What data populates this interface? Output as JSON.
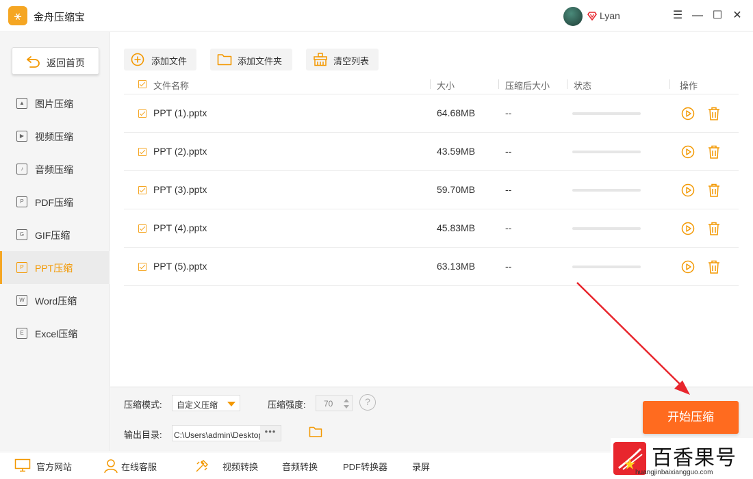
{
  "app": {
    "title": "金舟压缩宝",
    "user": "Lyan"
  },
  "window_controls": {
    "menu": "☰",
    "minimize": "—",
    "maximize": "☐",
    "close": "✕"
  },
  "sidebar": {
    "home_label": "返回首页",
    "items": [
      {
        "label": "图片压缩",
        "icon": "image-icon",
        "glyph": "▲"
      },
      {
        "label": "视频压缩",
        "icon": "video-icon",
        "glyph": "▶"
      },
      {
        "label": "音频压缩",
        "icon": "audio-icon",
        "glyph": "♪"
      },
      {
        "label": "PDF压缩",
        "icon": "pdf-icon",
        "glyph": "P"
      },
      {
        "label": "GIF压缩",
        "icon": "gif-icon",
        "glyph": "G"
      },
      {
        "label": "PPT压缩",
        "icon": "ppt-icon",
        "glyph": "P",
        "active": true
      },
      {
        "label": "Word压缩",
        "icon": "word-icon",
        "glyph": "W"
      },
      {
        "label": "Excel压缩",
        "icon": "excel-icon",
        "glyph": "E"
      }
    ]
  },
  "toolbar": {
    "add_file": "添加文件",
    "add_folder": "添加文件夹",
    "clear_list": "清空列表"
  },
  "table": {
    "headers": {
      "name": "文件名称",
      "size": "大小",
      "compressed_size": "压缩后大小",
      "status": "状态",
      "actions": "操作"
    },
    "rows": [
      {
        "name": "PPT (1).pptx",
        "size": "64.68MB",
        "compressed": "--",
        "progress": 0
      },
      {
        "name": "PPT (2).pptx",
        "size": "43.59MB",
        "compressed": "--",
        "progress": 0
      },
      {
        "name": "PPT (3).pptx",
        "size": "59.70MB",
        "compressed": "--",
        "progress": 0
      },
      {
        "name": "PPT (4).pptx",
        "size": "45.83MB",
        "compressed": "--",
        "progress": 0
      },
      {
        "name": "PPT (5).pptx",
        "size": "63.13MB",
        "compressed": "--",
        "progress": 0
      }
    ]
  },
  "settings": {
    "mode_label": "压缩模式:",
    "mode_value": "自定义压缩",
    "strength_label": "压缩强度:",
    "strength_value": "70",
    "help": "?",
    "output_label": "输出目录:",
    "output_value": "C:\\Users\\admin\\Desktop\\金舟压缩宝",
    "more": "•••",
    "start": "开始压缩"
  },
  "footer": {
    "website": "官方网站",
    "support": "在线客服",
    "video_convert": "视频转换",
    "audio_convert": "音频转换",
    "pdf_convert": "PDF转换器",
    "record": "录屏"
  },
  "watermark": {
    "text": "百香果号",
    "url": "huangjinbaixiangguo.com"
  },
  "colors": {
    "accent": "#f5a623",
    "active_text": "#f39800",
    "start_button": "#ff6b1f",
    "annotation": "#e8262d"
  }
}
